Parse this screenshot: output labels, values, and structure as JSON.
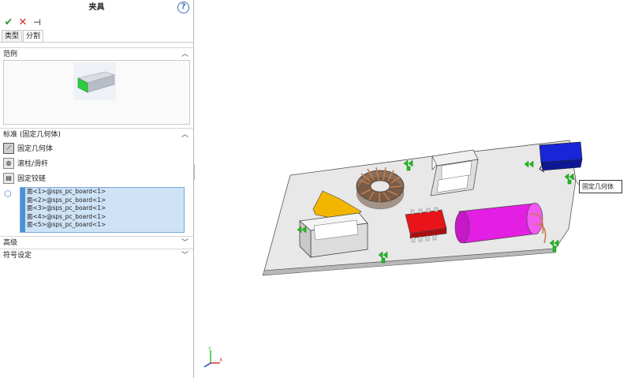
{
  "panel": {
    "title": "夹具",
    "help_icon": "?",
    "tabs": [
      "类型",
      "分割"
    ],
    "sections": {
      "example": "范例",
      "standard": "标准 (固定几何体)",
      "advanced": "高级",
      "symbol": "符号设定"
    },
    "standard_options": [
      "固定几何体",
      "滚柱/滑杆",
      "固定铰链"
    ],
    "faces": [
      "面<1>@sps_pc_board<1>",
      "面<2>@sps_pc_board<1>",
      "面<3>@sps_pc_board<1>",
      "面<4>@sps_pc_board<1>",
      "面<5>@sps_pc_board<1>"
    ]
  },
  "viewport": {
    "tooltip": "固定几何体",
    "axis_labels": {
      "y": "Y",
      "x": "X"
    }
  },
  "colors": {
    "selection_bg": "#cfe3f7",
    "fixture_green": "#1fbf1f",
    "board": "#e6e6e6",
    "capacitor": "#e21fe2",
    "chip": "#e8141a",
    "bracket": "#f2b600",
    "battery": "#1826d8"
  }
}
